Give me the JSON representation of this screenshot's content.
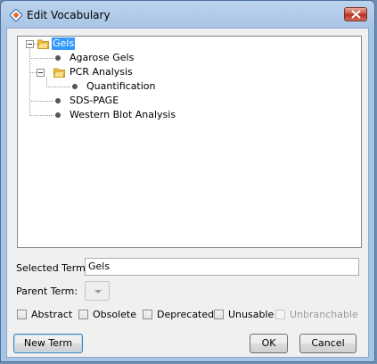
{
  "window": {
    "title": "Edit Vocabulary"
  },
  "tree": {
    "nodes": [
      {
        "label": "Gels",
        "selected": true,
        "type": "folder",
        "expanded": true
      },
      {
        "label": "Agarose Gels",
        "type": "leaf"
      },
      {
        "label": "PCR Analysis",
        "type": "folder",
        "expanded": true
      },
      {
        "label": "Quantification",
        "type": "leaf"
      },
      {
        "label": "SDS-PAGE",
        "type": "leaf"
      },
      {
        "label": "Western Blot Analysis",
        "type": "leaf"
      }
    ]
  },
  "form": {
    "selected_term_label": "Selected Term:",
    "selected_term_value": "Gels",
    "parent_term_label": "Parent Term:"
  },
  "checkboxes": [
    {
      "label": "Abstract",
      "checked": false,
      "enabled": true
    },
    {
      "label": "Obsolete",
      "checked": false,
      "enabled": true
    },
    {
      "label": "Deprecated",
      "checked": false,
      "enabled": true
    },
    {
      "label": "Unusable",
      "checked": false,
      "enabled": true
    },
    {
      "label": "Unbranchable",
      "checked": false,
      "enabled": false
    }
  ],
  "buttons": {
    "new_term": "New Term",
    "ok": "OK",
    "cancel": "Cancel"
  },
  "colors": {
    "selection": "#3399ff",
    "titlebar": "#bcd3ec",
    "close": "#c8493a"
  }
}
